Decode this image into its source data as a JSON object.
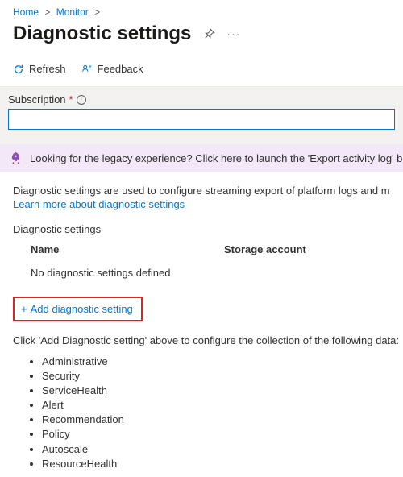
{
  "breadcrumb": {
    "home": "Home",
    "monitor": "Monitor"
  },
  "header": {
    "title": "Diagnostic settings"
  },
  "toolbar": {
    "refresh": "Refresh",
    "feedback": "Feedback"
  },
  "field": {
    "subscription_label": "Subscription",
    "subscription_value": ""
  },
  "banner": {
    "legacy": "Looking for the legacy experience? Click here to launch the 'Export activity log' blade"
  },
  "description": {
    "text": "Diagnostic settings are used to configure streaming export of platform logs and metrics",
    "learn_more": "Learn more about diagnostic settings"
  },
  "table": {
    "section_label": "Diagnostic settings",
    "col_name": "Name",
    "col_storage": "Storage account",
    "empty": "No diagnostic settings defined",
    "add_label": "Add diagnostic setting"
  },
  "hint": {
    "text": "Click 'Add Diagnostic setting' above to configure the collection of the following data:"
  },
  "categories": [
    "Administrative",
    "Security",
    "ServiceHealth",
    "Alert",
    "Recommendation",
    "Policy",
    "Autoscale",
    "ResourceHealth"
  ]
}
